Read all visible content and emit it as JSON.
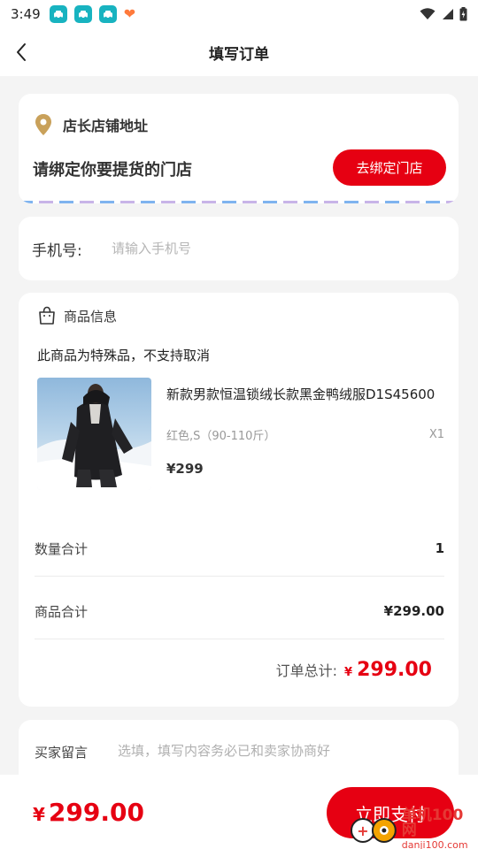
{
  "status_bar": {
    "time": "3:49",
    "app_icons": [
      "car-app-icon",
      "car-app-icon",
      "car-app-icon"
    ],
    "heart_icon": "heart-icon",
    "right_icons": [
      "wifi-icon",
      "signal-icon",
      "battery-icon"
    ]
  },
  "header": {
    "title": "填写订单",
    "back_icon": "chevron-left-icon"
  },
  "store": {
    "title": "店长店铺地址",
    "prompt": "请绑定你要提货的门店",
    "bind_button": "去绑定门店",
    "icon": "location-pin-icon"
  },
  "phone": {
    "label": "手机号:",
    "placeholder": "请输入手机号"
  },
  "goods": {
    "header": "商品信息",
    "header_icon": "shopping-bag-icon",
    "notice": "此商品为特殊品，不支持取消",
    "product": {
      "name": "新款男款恒温锁绒长款黑金鸭绒服D1S45600",
      "spec": "红色,S（90-110斤）",
      "qty": "X1",
      "price": "¥299"
    },
    "quantity_total_label": "数量合计",
    "quantity_total_value": "1",
    "goods_total_label": "商品合计",
    "goods_total_value": "¥299.00",
    "order_total_label": "订单总计:",
    "order_total_currency": "¥",
    "order_total_value": "299.00"
  },
  "message": {
    "label": "买家留言",
    "placeholder": "选填，填写内容务必已和卖家协商好"
  },
  "bottom": {
    "currency": "¥",
    "total": "299.00",
    "pay_button": "立即支付"
  },
  "watermark": {
    "text": "单机100网",
    "url": "danji100.com"
  },
  "colors": {
    "accent": "#e60012",
    "background": "#f4f4f4",
    "card": "#ffffff",
    "status_app": "#18b3c0",
    "pin": "#c9a15a"
  }
}
